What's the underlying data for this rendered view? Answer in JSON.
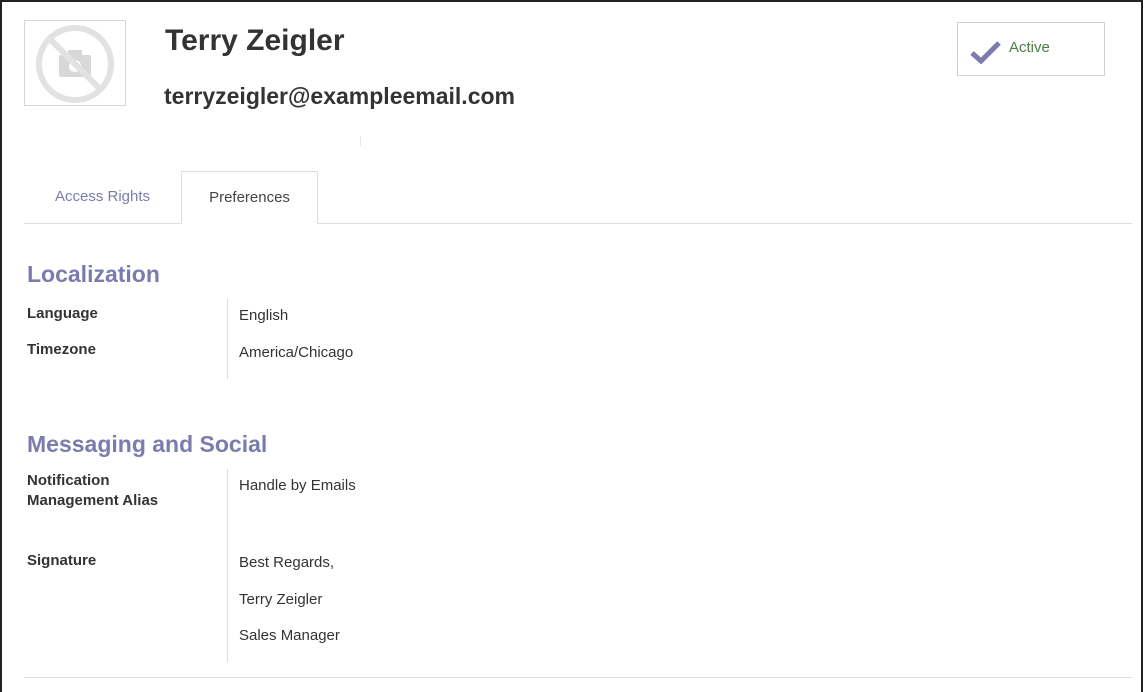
{
  "user": {
    "name": "Terry Zeigler",
    "email": "terryzeigler@exampleemail.com",
    "avatar_icon": "no-photo-camera-icon"
  },
  "status": {
    "label": "Active",
    "icon": "checkmark-icon",
    "color": "#7c7bad"
  },
  "tabs": [
    {
      "label": "Access Rights",
      "active": false
    },
    {
      "label": "Preferences",
      "active": true
    }
  ],
  "localization": {
    "title": "Localization",
    "language": {
      "label": "Language",
      "value": "English"
    },
    "timezone": {
      "label": "Timezone",
      "value": "America/Chicago"
    }
  },
  "messaging": {
    "title": "Messaging and Social",
    "notification": {
      "label": "Notification Management Alias",
      "value": "Handle by Emails"
    },
    "signature": {
      "label": "Signature",
      "lines": [
        "Best Regards,",
        "Terry Zeigler",
        "Sales Manager"
      ]
    }
  },
  "colors": {
    "accent": "#7c7bad",
    "text": "#333333",
    "border": "#dddddd"
  }
}
